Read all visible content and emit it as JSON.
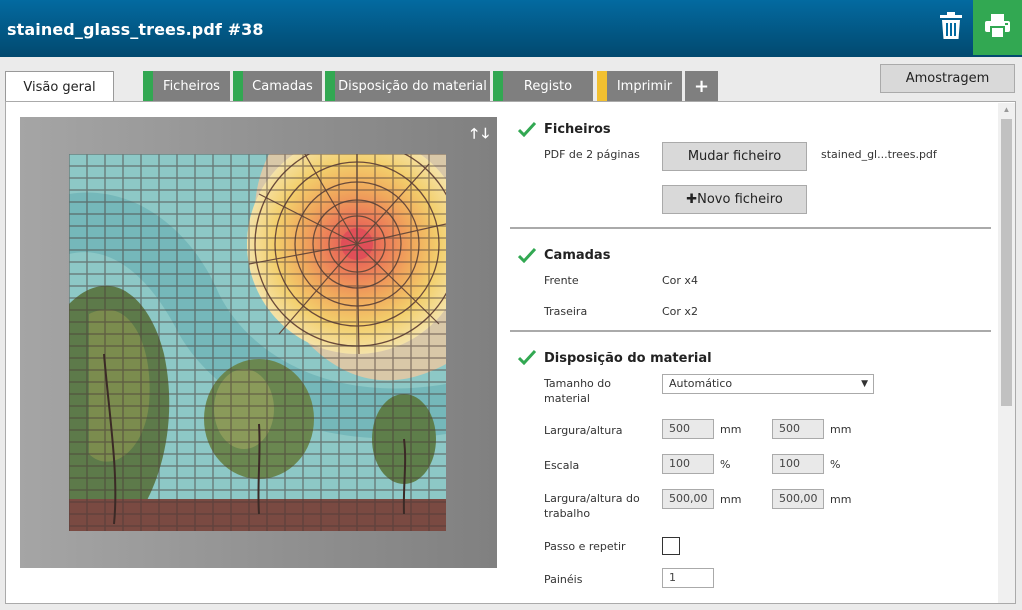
{
  "window": {
    "title": "stained_glass_trees.pdf #38"
  },
  "tabs": [
    {
      "label": "Visão geral",
      "stripe": ""
    },
    {
      "label": "Ficheiros",
      "stripe": "#32a852"
    },
    {
      "label": "Camadas",
      "stripe": "#32a852"
    },
    {
      "label": "Disposição do material",
      "stripe": "#32a852"
    },
    {
      "label": "Registo",
      "stripe": "#32a852"
    },
    {
      "label": "Imprimir",
      "stripe": "#f2c030"
    },
    {
      "label": "+"
    }
  ],
  "sampling_label": "Amostragem",
  "preview": {
    "arrows": "🡑 🡓"
  },
  "files": {
    "title": "Ficheiros",
    "desc": "PDF de 2 páginas",
    "change_button": "Mudar ficheiro",
    "filename": "stained_gl...trees.pdf",
    "new_button": "Novo ficheiro",
    "new_icon": "✚"
  },
  "layers": {
    "title": "Camadas",
    "front_label": "Frente",
    "front_value": "Cor x4",
    "back_label": "Traseira",
    "back_value": "Cor x2"
  },
  "media": {
    "title": "Disposição do material",
    "size_label": "Tamanho do material",
    "size_value": "Automático",
    "wh_label": "Largura/altura",
    "width": "500",
    "height": "500",
    "unit_mm": "mm",
    "scale_label": "Escala",
    "scale_x": "100",
    "scale_y": "100",
    "unit_pct": "%",
    "job_wh_label": "Largura/altura do trabalho",
    "job_width": "500,00",
    "job_height": "500,00",
    "step_label": "Passo e repetir",
    "panels_label": "Painéis",
    "panels_value": "1"
  },
  "colors": {
    "accent_green": "#32a852",
    "title_blue": "#036aa0",
    "print_yellow": "#f2c030"
  }
}
